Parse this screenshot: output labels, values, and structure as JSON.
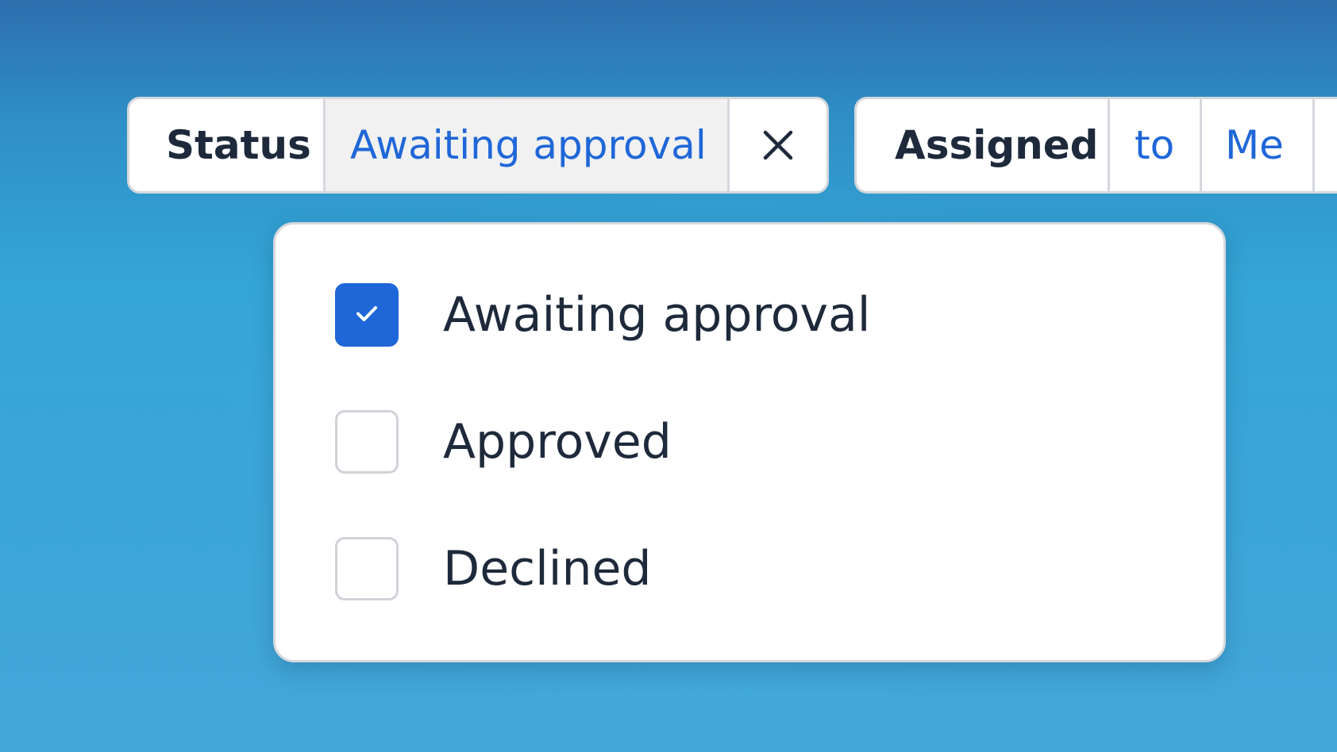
{
  "colors": {
    "accent": "#1f67d8",
    "text": "#1e2a3b",
    "border": "#d4d8dd",
    "selected_segment_bg": "#f1f1f1"
  },
  "filters": {
    "status": {
      "label": "Status",
      "value": "Awaiting approval",
      "clear_icon": "close-icon"
    },
    "assigned": {
      "label": "Assigned",
      "operator": "to",
      "value": "Me"
    }
  },
  "dropdown": {
    "options": [
      {
        "label": "Awaiting approval",
        "checked": true
      },
      {
        "label": "Approved",
        "checked": false
      },
      {
        "label": "Declined",
        "checked": false
      }
    ],
    "check_icon": "check-icon"
  }
}
